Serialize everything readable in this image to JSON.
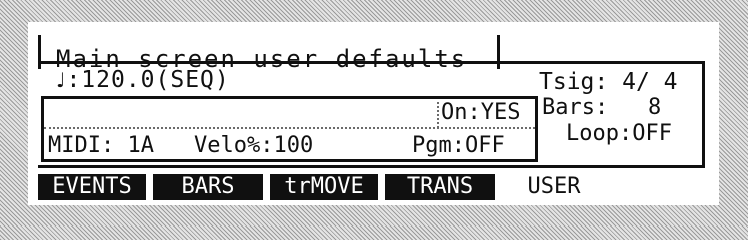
{
  "screen_title": "Main screen user defaults",
  "tempo": {
    "icon": "quarter-note-icon",
    "glyph": "♩",
    "text": ":120.0(SEQ)"
  },
  "on": {
    "label": "On:",
    "value": "YES"
  },
  "midi": {
    "label": "MIDI:",
    "value": "1A"
  },
  "velo": {
    "label": "Velo%:",
    "value": "100"
  },
  "pgm": {
    "label": "Pgm:",
    "value": "OFF"
  },
  "tsig": {
    "label": "Tsig:",
    "value": "4/ 4"
  },
  "bars": {
    "label": "Bars:",
    "value": "8"
  },
  "loop": {
    "label": "Loop:",
    "value": "OFF"
  },
  "tabs": [
    {
      "label": "EVENTS",
      "active": false
    },
    {
      "label": "BARS",
      "active": false
    },
    {
      "label": "trMOVE",
      "active": false
    },
    {
      "label": "TRANS",
      "active": false
    },
    {
      "label": "USER",
      "active": true
    }
  ]
}
